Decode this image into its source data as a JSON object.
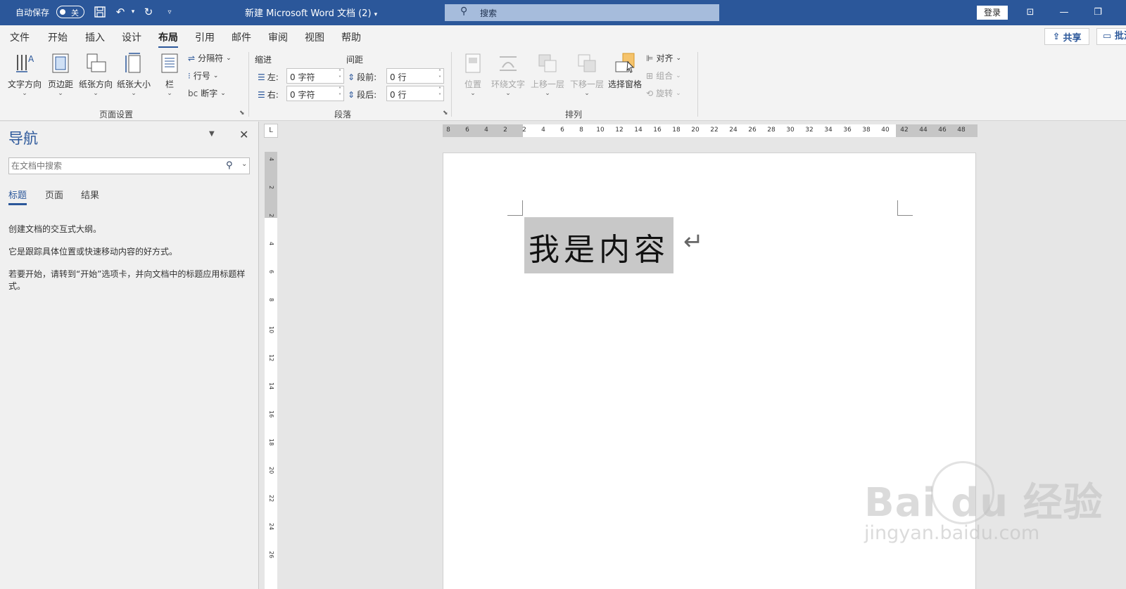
{
  "titlebar": {
    "autosave_label": "自动保存",
    "autosave_state": "关",
    "doc_title": "新建 Microsoft Word 文档 (2)",
    "search_placeholder": "搜索",
    "login_label": "登录",
    "colors": {
      "bar": "#2b579a",
      "search": "#a6bcdc"
    }
  },
  "menu": {
    "tabs": [
      {
        "label": "文件"
      },
      {
        "label": "开始"
      },
      {
        "label": "插入"
      },
      {
        "label": "设计"
      },
      {
        "label": "布局",
        "active": true
      },
      {
        "label": "引用"
      },
      {
        "label": "邮件"
      },
      {
        "label": "审阅"
      },
      {
        "label": "视图"
      },
      {
        "label": "帮助"
      }
    ],
    "share_label": "共享",
    "comment_label": "批注"
  },
  "ribbon": {
    "page_setup": {
      "label": "页面设置",
      "buttons": [
        "文字方向",
        "页边距",
        "纸张方向",
        "纸张大小",
        "栏"
      ],
      "small": [
        "分隔符",
        "行号",
        "断字"
      ]
    },
    "paragraph": {
      "label": "段落",
      "indent_head": "缩进",
      "spacing_head": "间距",
      "left_label": "左:",
      "left_value": "0 字符",
      "right_label": "右:",
      "right_value": "0 字符",
      "before_label": "段前:",
      "before_value": "0 行",
      "after_label": "段后:",
      "after_value": "0 行"
    },
    "arrange": {
      "label": "排列",
      "buttons": [
        "位置",
        "环绕文字",
        "上移一层",
        "下移一层",
        "选择窗格"
      ],
      "small": [
        "对齐",
        "组合",
        "旋转"
      ]
    }
  },
  "nav": {
    "title": "导航",
    "search_placeholder": "在文档中搜索",
    "tabs": [
      "标题",
      "页面",
      "结果"
    ],
    "paragraphs": [
      "创建文档的交互式大纲。",
      "它是跟踪具体位置或快速移动内容的好方式。",
      "若要开始，请转到“开始”选项卡，并向文档中的标题应用标题样式。"
    ]
  },
  "ruler": {
    "corner": "L",
    "h_ticks": [
      "8",
      "6",
      "4",
      "2",
      "2",
      "4",
      "6",
      "8",
      "10",
      "12",
      "14",
      "16",
      "18",
      "20",
      "22",
      "24",
      "26",
      "28",
      "30",
      "32",
      "34",
      "36",
      "38",
      "40",
      "42",
      "44",
      "46",
      "48"
    ],
    "v_ticks": [
      "4",
      "2",
      "2",
      "4",
      "6",
      "8",
      "10",
      "12",
      "14",
      "16",
      "18",
      "20",
      "22",
      "24",
      "26"
    ]
  },
  "document": {
    "text": "我是内容"
  },
  "watermark": {
    "main": "Bai du 经验",
    "url": "jingyan.baidu.com"
  }
}
